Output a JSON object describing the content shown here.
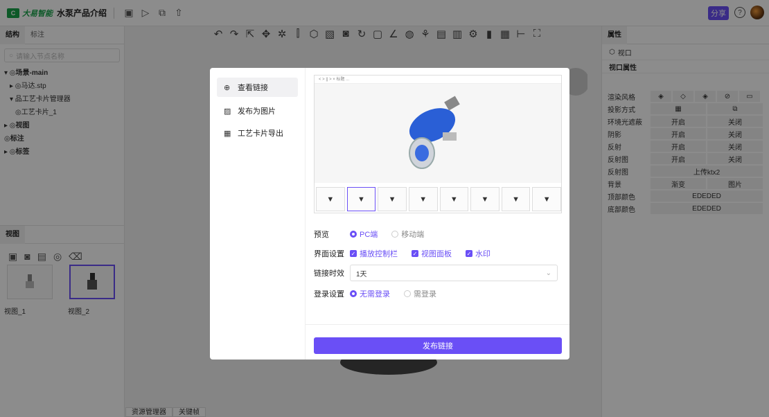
{
  "topbar": {
    "logo_mark": "C",
    "brand": "大易智能",
    "app_title": "水泵产品介绍",
    "share_label": "分享",
    "help_glyph": "?"
  },
  "left_panel": {
    "tabs": [
      "结构",
      "标注"
    ],
    "search_placeholder": "请输入节点名称",
    "tree": [
      {
        "label": "▾ ◎场景-main",
        "indent": 0,
        "bold": true
      },
      {
        "label": "▸ ◎马达.stp",
        "indent": 1,
        "bold": false
      },
      {
        "label": "▾ 品工艺卡片管理器",
        "indent": 1,
        "bold": false
      },
      {
        "label": "◎工艺卡片_1",
        "indent": 2,
        "bold": false
      },
      {
        "label": "▸ ◎视图",
        "indent": 0,
        "bold": true
      },
      {
        "label": "◎标注",
        "indent": 0,
        "bold": true
      },
      {
        "label": "▸ ◎标签",
        "indent": 0,
        "bold": true
      }
    ],
    "view_tab": "视图",
    "view_tools": [
      "▣",
      "◙",
      "▤",
      "◎",
      "⌫"
    ],
    "views": [
      {
        "label": "视图_1"
      },
      {
        "label": "视图_2"
      }
    ]
  },
  "bottom_tabs": [
    "资源管理器",
    "关键帧"
  ],
  "right_panel": {
    "tab": "属性",
    "viewport_label": "视口",
    "section_title": "视口属性",
    "rows": [
      {
        "label": "渲染风格",
        "cells": [
          "◈",
          "◇",
          "◈",
          "⊘",
          "▭"
        ]
      },
      {
        "label": "投影方式",
        "cells": [
          "▦",
          "⧉"
        ]
      },
      {
        "label": "环境光遮蔽",
        "cells": [
          "开启",
          "关闭"
        ]
      },
      {
        "label": "阴影",
        "cells": [
          "开启",
          "关闭"
        ]
      },
      {
        "label": "反射",
        "cells": [
          "开启",
          "关闭"
        ]
      },
      {
        "label": "反射图",
        "cells": [
          "开启",
          "关闭"
        ]
      },
      {
        "label": "反射图",
        "cells": [
          "上传ktx2"
        ]
      },
      {
        "label": "背景",
        "cells": [
          "渐变",
          "图片"
        ]
      },
      {
        "label": "顶部颜色",
        "cells": [
          "EDEDED"
        ]
      },
      {
        "label": "底部颜色",
        "cells": [
          "EDEDED"
        ]
      }
    ]
  },
  "modal": {
    "menu": [
      {
        "icon": "⊕",
        "label": "查看链接",
        "active": true
      },
      {
        "icon": "▨",
        "label": "发布为图片",
        "active": false
      },
      {
        "icon": "▦",
        "label": "工艺卡片导出",
        "active": false
      }
    ],
    "preview_header": "< > || > ×  标题 ...",
    "preview_strip_label": "视图",
    "preview_row": {
      "label": "预览",
      "options": [
        {
          "text": "PC端",
          "on": true
        },
        {
          "text": "移动端",
          "on": false
        }
      ]
    },
    "ui_row": {
      "label": "界面设置",
      "options": [
        "播放控制栏",
        "视图面板",
        "水印"
      ]
    },
    "expiry_row": {
      "label": "链接时效",
      "value": "1天"
    },
    "login_row": {
      "label": "登录设置",
      "options": [
        {
          "text": "无需登录",
          "on": true
        },
        {
          "text": "需登录",
          "on": false
        }
      ]
    },
    "publish_label": "发布链接"
  },
  "colors": {
    "accent": "#6a4ff6",
    "brand_green": "#19a24a"
  }
}
